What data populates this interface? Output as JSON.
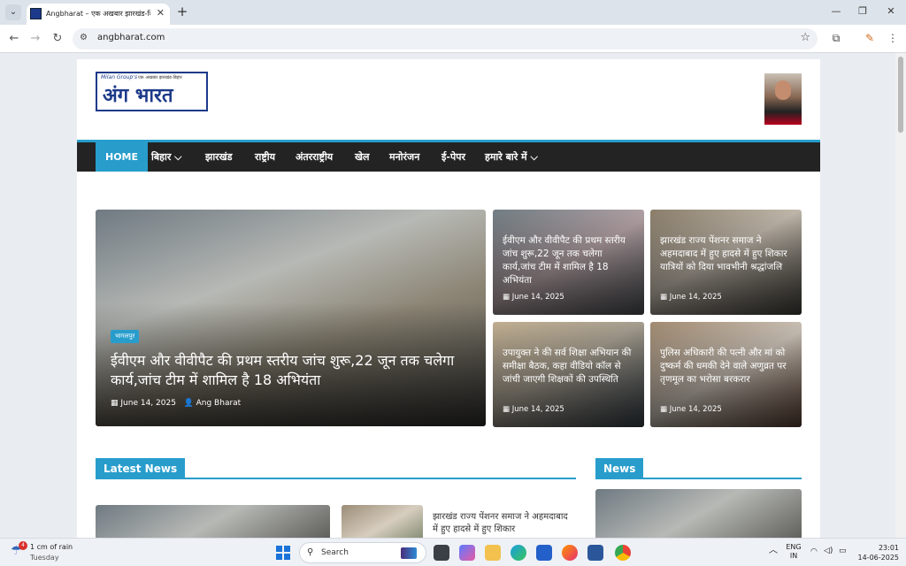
{
  "browser": {
    "tab_title": "Angbharat – एक अखबार झारखंड-बि",
    "tab_close": "✕",
    "new_tab": "+",
    "url": "angbharat.com",
    "window_controls": [
      "—",
      "❐",
      "✕"
    ]
  },
  "site": {
    "logo_top": "Milan Group's",
    "logo_sub": "एक अखबार झारखंड-बिहार",
    "logo_main": "अंग भारत",
    "nav": [
      {
        "label": "HOME"
      },
      {
        "label": "बिहार ⌵"
      },
      {
        "label": "झारखंड"
      },
      {
        "label": "राष्ट्रीय"
      },
      {
        "label": "अंतरराष्ट्रीय"
      },
      {
        "label": "खेल"
      },
      {
        "label": "मनोरंजन"
      },
      {
        "label": "ई-पेपर"
      },
      {
        "label": "हमारे बारे में ⌵"
      }
    ]
  },
  "featured": {
    "main": {
      "category": "भागलपुर",
      "title": "ईवीएम और वीवीपैट की प्रथम स्तरीय जांच शुरू,22 जून तक चलेगा कार्य,जांच टीम में शामिल है 18 अभियंता",
      "date": "June 14, 2025",
      "author": "Ang Bharat"
    },
    "cards": [
      {
        "title": "ईवीएम और वीवीपैट की प्रथम स्तरीय जांच शुरू,22 जून तक चलेगा कार्य,जांच टीम में शामिल है 18 अभियंता",
        "date": "June 14, 2025"
      },
      {
        "title": "झारखंड राज्य पेंशनर समाज ने अहमदाबाद में हुए हादसे में हुए शिकार यात्रियों को दिया भावभीनी श्रद्धांजलि",
        "date": "June 14, 2025"
      },
      {
        "title": "उपायुक्त ने की सर्व शिक्षा अभियान की समीक्षा बैठक, कहा वीडियो कॉल से जांची जाएगी शिक्षकों की उपस्थिति",
        "date": "June 14, 2025"
      },
      {
        "title": "पुलिस अधिकारी की पत्नी और मां को दुष्कर्म की धमकी देने वाले अणुव्रत पर तृणमूल का भरोसा बरकरार",
        "date": "June 14, 2025"
      }
    ]
  },
  "sections": {
    "latest_news": "Latest News",
    "news": "News",
    "latest_item_text": "झारखंड राज्य पेंशनर समाज ने अहमदाबाद में हुए हादसे में हुए शिकार"
  },
  "taskbar": {
    "weather_badge": "4",
    "weather_line1": "1 cm of rain",
    "weather_line2": "Tuesday",
    "search_placeholder": "Search",
    "lang_line1": "ENG",
    "lang_line2": "IN",
    "time": "23:01",
    "date": "14-06-2025"
  }
}
